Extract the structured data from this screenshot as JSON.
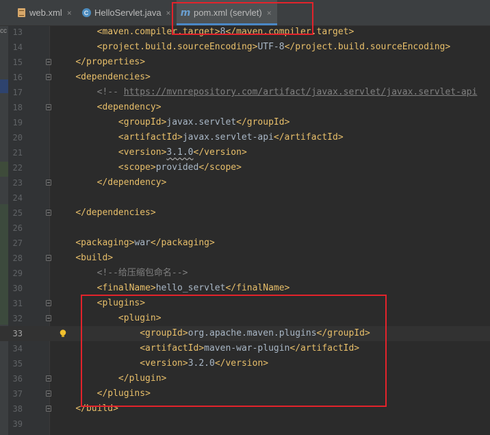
{
  "tabs": [
    {
      "label": "web.xml",
      "icon": "xml-file-icon",
      "active": false
    },
    {
      "label": "HelloServlet.java",
      "icon": "java-class-icon",
      "active": false
    },
    {
      "label": "pom.xml (servlet)",
      "icon": "maven-m-icon",
      "active": true
    }
  ],
  "close_glyph": "×",
  "left_panel_caption": "cc",
  "lines": [
    {
      "n": "13",
      "segs": [
        [
          "",
          "        "
        ],
        [
          "tag",
          "<maven.compiler.target>"
        ],
        [
          "txt",
          "8"
        ],
        [
          "tag",
          "</maven.compiler.target>"
        ]
      ]
    },
    {
      "n": "14",
      "segs": [
        [
          "",
          "        "
        ],
        [
          "tag",
          "<project.build.sourceEncoding>"
        ],
        [
          "txt",
          "UTF-8"
        ],
        [
          "tag",
          "</project.build.sourceEncoding>"
        ]
      ]
    },
    {
      "n": "15",
      "segs": [
        [
          "",
          "    "
        ],
        [
          "tag",
          "</properties>"
        ]
      ]
    },
    {
      "n": "16",
      "segs": [
        [
          "",
          "    "
        ],
        [
          "tag",
          "<dependencies>"
        ]
      ]
    },
    {
      "n": "17",
      "segs": [
        [
          "",
          "        "
        ],
        [
          "cmt",
          "<!-- "
        ],
        [
          "url",
          "https://mvnrepository.com/artifact/javax.servlet/javax.servlet-api"
        ]
      ]
    },
    {
      "n": "18",
      "segs": [
        [
          "",
          "        "
        ],
        [
          "tag",
          "<dependency>"
        ]
      ]
    },
    {
      "n": "19",
      "segs": [
        [
          "",
          "            "
        ],
        [
          "tag",
          "<groupId>"
        ],
        [
          "txt",
          "javax.servlet"
        ],
        [
          "tag",
          "</groupId>"
        ]
      ]
    },
    {
      "n": "20",
      "segs": [
        [
          "",
          "            "
        ],
        [
          "tag",
          "<artifactId>"
        ],
        [
          "txt",
          "javax.servlet-api"
        ],
        [
          "tag",
          "</artifactId>"
        ]
      ]
    },
    {
      "n": "21",
      "segs": [
        [
          "",
          "            "
        ],
        [
          "tag",
          "<version>"
        ],
        [
          "wavy",
          "3.1.0"
        ],
        [
          "tag",
          "</version>"
        ]
      ]
    },
    {
      "n": "22",
      "segs": [
        [
          "",
          "            "
        ],
        [
          "tag",
          "<scope>"
        ],
        [
          "txt",
          "provided"
        ],
        [
          "tag",
          "</scope>"
        ]
      ]
    },
    {
      "n": "23",
      "segs": [
        [
          "",
          "        "
        ],
        [
          "tag",
          "</dependency>"
        ]
      ]
    },
    {
      "n": "24",
      "segs": []
    },
    {
      "n": "25",
      "segs": [
        [
          "",
          "    "
        ],
        [
          "tag",
          "</dependencies>"
        ]
      ]
    },
    {
      "n": "26",
      "segs": []
    },
    {
      "n": "27",
      "segs": [
        [
          "",
          "    "
        ],
        [
          "tag",
          "<packaging>"
        ],
        [
          "txt",
          "war"
        ],
        [
          "tag",
          "</packaging>"
        ]
      ]
    },
    {
      "n": "28",
      "segs": [
        [
          "",
          "    "
        ],
        [
          "tag",
          "<build>"
        ]
      ]
    },
    {
      "n": "29",
      "segs": [
        [
          "",
          "        "
        ],
        [
          "cmt",
          "<!--给压缩包命名-->"
        ]
      ]
    },
    {
      "n": "30",
      "segs": [
        [
          "",
          "        "
        ],
        [
          "tag",
          "<finalName>"
        ],
        [
          "txt",
          "hello_servlet"
        ],
        [
          "tag",
          "</finalName>"
        ]
      ]
    },
    {
      "n": "31",
      "segs": [
        [
          "",
          "        "
        ],
        [
          "tag",
          "<plugins>"
        ]
      ]
    },
    {
      "n": "32",
      "segs": [
        [
          "",
          "            "
        ],
        [
          "tag",
          "<plugin>"
        ]
      ]
    },
    {
      "n": "33",
      "segs": [
        [
          "",
          "                "
        ],
        [
          "tag",
          "<groupId>"
        ],
        [
          "txt",
          "org.apache.maven.plugins"
        ],
        [
          "tag",
          "</groupId>"
        ]
      ],
      "current": true
    },
    {
      "n": "34",
      "segs": [
        [
          "",
          "                "
        ],
        [
          "tag",
          "<artifactId>"
        ],
        [
          "txt",
          "maven-war-plugin"
        ],
        [
          "tag",
          "</artifactId>"
        ]
      ]
    },
    {
      "n": "35",
      "segs": [
        [
          "",
          "                "
        ],
        [
          "tag",
          "<version>"
        ],
        [
          "txt",
          "3.2.0"
        ],
        [
          "tag",
          "</version>"
        ]
      ]
    },
    {
      "n": "36",
      "segs": [
        [
          "",
          "            "
        ],
        [
          "tag",
          "</plugin>"
        ]
      ]
    },
    {
      "n": "37",
      "segs": [
        [
          "",
          "        "
        ],
        [
          "tag",
          "</plugins>"
        ]
      ]
    },
    {
      "n": "38",
      "segs": [
        [
          "",
          "    "
        ],
        [
          "tag",
          "</build>"
        ]
      ]
    },
    {
      "n": "39",
      "segs": []
    }
  ],
  "fold_lines": [
    "15",
    "16",
    "18",
    "23",
    "25",
    "28",
    "31",
    "32",
    "36",
    "37",
    "38"
  ],
  "colors": {
    "tag": "#e8bf6a",
    "text": "#a9b7c6",
    "comment": "#808080",
    "annotation": "#e3232b",
    "tab_underline": "#4a88c7"
  }
}
